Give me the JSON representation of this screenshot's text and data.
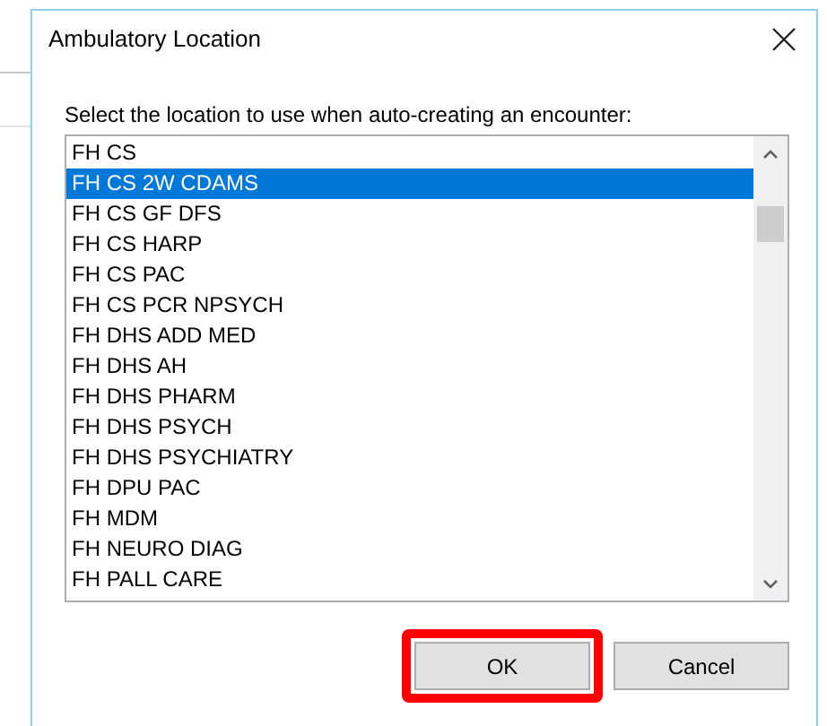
{
  "window": {
    "title": "Ambulatory Location"
  },
  "prompt": "Select the location to use when auto-creating an encounter:",
  "locations": [
    {
      "label": "FH CS",
      "selected": false
    },
    {
      "label": "FH CS 2W CDAMS",
      "selected": true
    },
    {
      "label": "FH CS GF DFS",
      "selected": false
    },
    {
      "label": "FH CS HARP",
      "selected": false
    },
    {
      "label": "FH CS PAC",
      "selected": false
    },
    {
      "label": "FH CS PCR NPSYCH",
      "selected": false
    },
    {
      "label": "FH DHS ADD MED",
      "selected": false
    },
    {
      "label": "FH DHS AH",
      "selected": false
    },
    {
      "label": "FH DHS PHARM",
      "selected": false
    },
    {
      "label": "FH DHS PSYCH",
      "selected": false
    },
    {
      "label": "FH DHS PSYCHIATRY",
      "selected": false
    },
    {
      "label": "FH DPU PAC",
      "selected": false
    },
    {
      "label": "FH MDM",
      "selected": false
    },
    {
      "label": "FH NEURO DIAG",
      "selected": false
    },
    {
      "label": "FH PALL CARE",
      "selected": false
    }
  ],
  "buttons": [
    {
      "label": "OK",
      "highlighted": true
    },
    {
      "label": "Cancel",
      "highlighted": false
    }
  ]
}
